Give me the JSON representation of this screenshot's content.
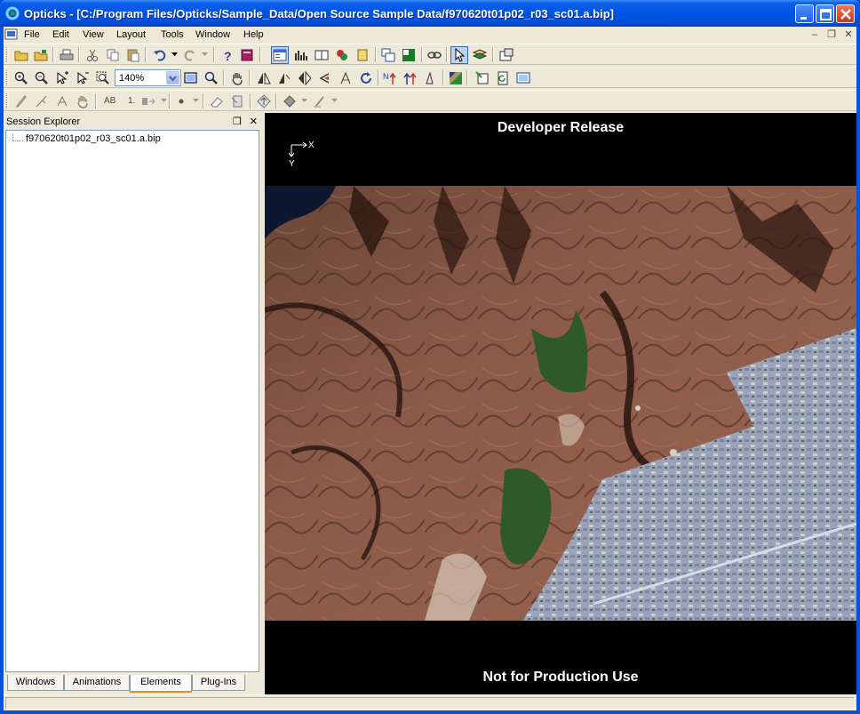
{
  "window": {
    "title": "Opticks - [C:/Program Files/Opticks/Sample_Data/Open Source Sample Data/f970620t01p02_r03_sc01.a.bip]",
    "accent": "#0054e3"
  },
  "menu": {
    "items": [
      "File",
      "Edit",
      "View",
      "Layout",
      "Tools",
      "Window",
      "Help"
    ]
  },
  "toolbar": {
    "zoom_value": "140%"
  },
  "session_explorer": {
    "title": "Session Explorer",
    "item": "f970620t01p02_r03_sc01.a.bip",
    "tabs": [
      "Windows",
      "Animations",
      "Elements",
      "Plug-Ins"
    ],
    "active_tab": "Elements"
  },
  "view": {
    "top_label": "Developer Release",
    "bottom_label": "Not for Production Use",
    "axis_x": "X",
    "axis_y": "Y"
  }
}
